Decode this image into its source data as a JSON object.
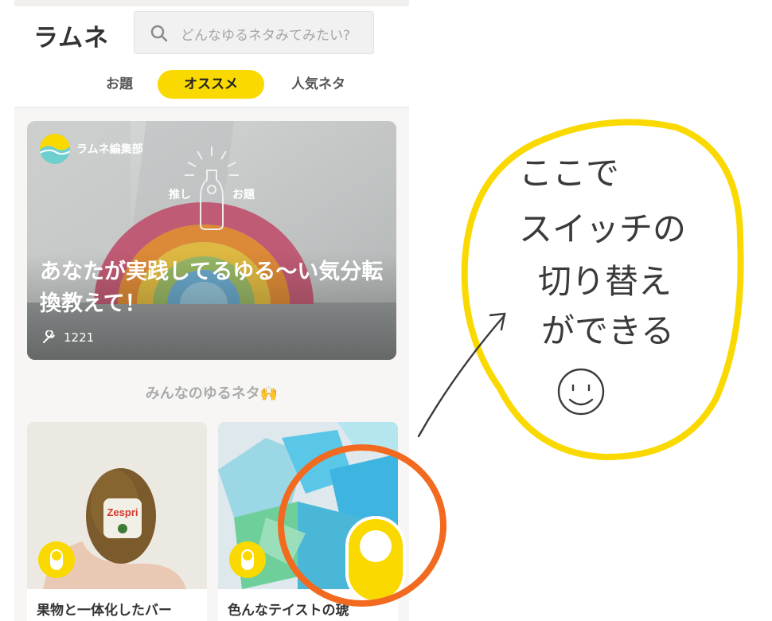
{
  "app": {
    "logo": "ラムネ"
  },
  "search": {
    "placeholder": "どんなゆるネタみてみたい?"
  },
  "tabs": [
    {
      "label": "お題",
      "active": false
    },
    {
      "label": "オススメ",
      "active": true
    },
    {
      "label": "人気ネタ",
      "active": false
    }
  ],
  "feature": {
    "author": "ラムネ編集部",
    "badge_left": "推し",
    "badge_right": "お題",
    "title": "あなたが実践してるゆる〜い気分転換教えて！",
    "count": "1221",
    "count_icon": "wrench-icon"
  },
  "section": {
    "label": "みんなのゆるネタ🙌"
  },
  "cards": [
    {
      "title": "果物と一体化したバー",
      "badge_icon": "switch-icon"
    },
    {
      "title": "色んなテイストの琥",
      "badge_icon": "switch-icon"
    }
  ],
  "annotation": {
    "note_lines": [
      "ここで",
      "スイッチの",
      "切り替え",
      "ができる"
    ],
    "smiley": "☺",
    "colors": {
      "yellow": "#fad900",
      "orange": "#f26a1f",
      "ink": "#3a3a3a"
    }
  }
}
